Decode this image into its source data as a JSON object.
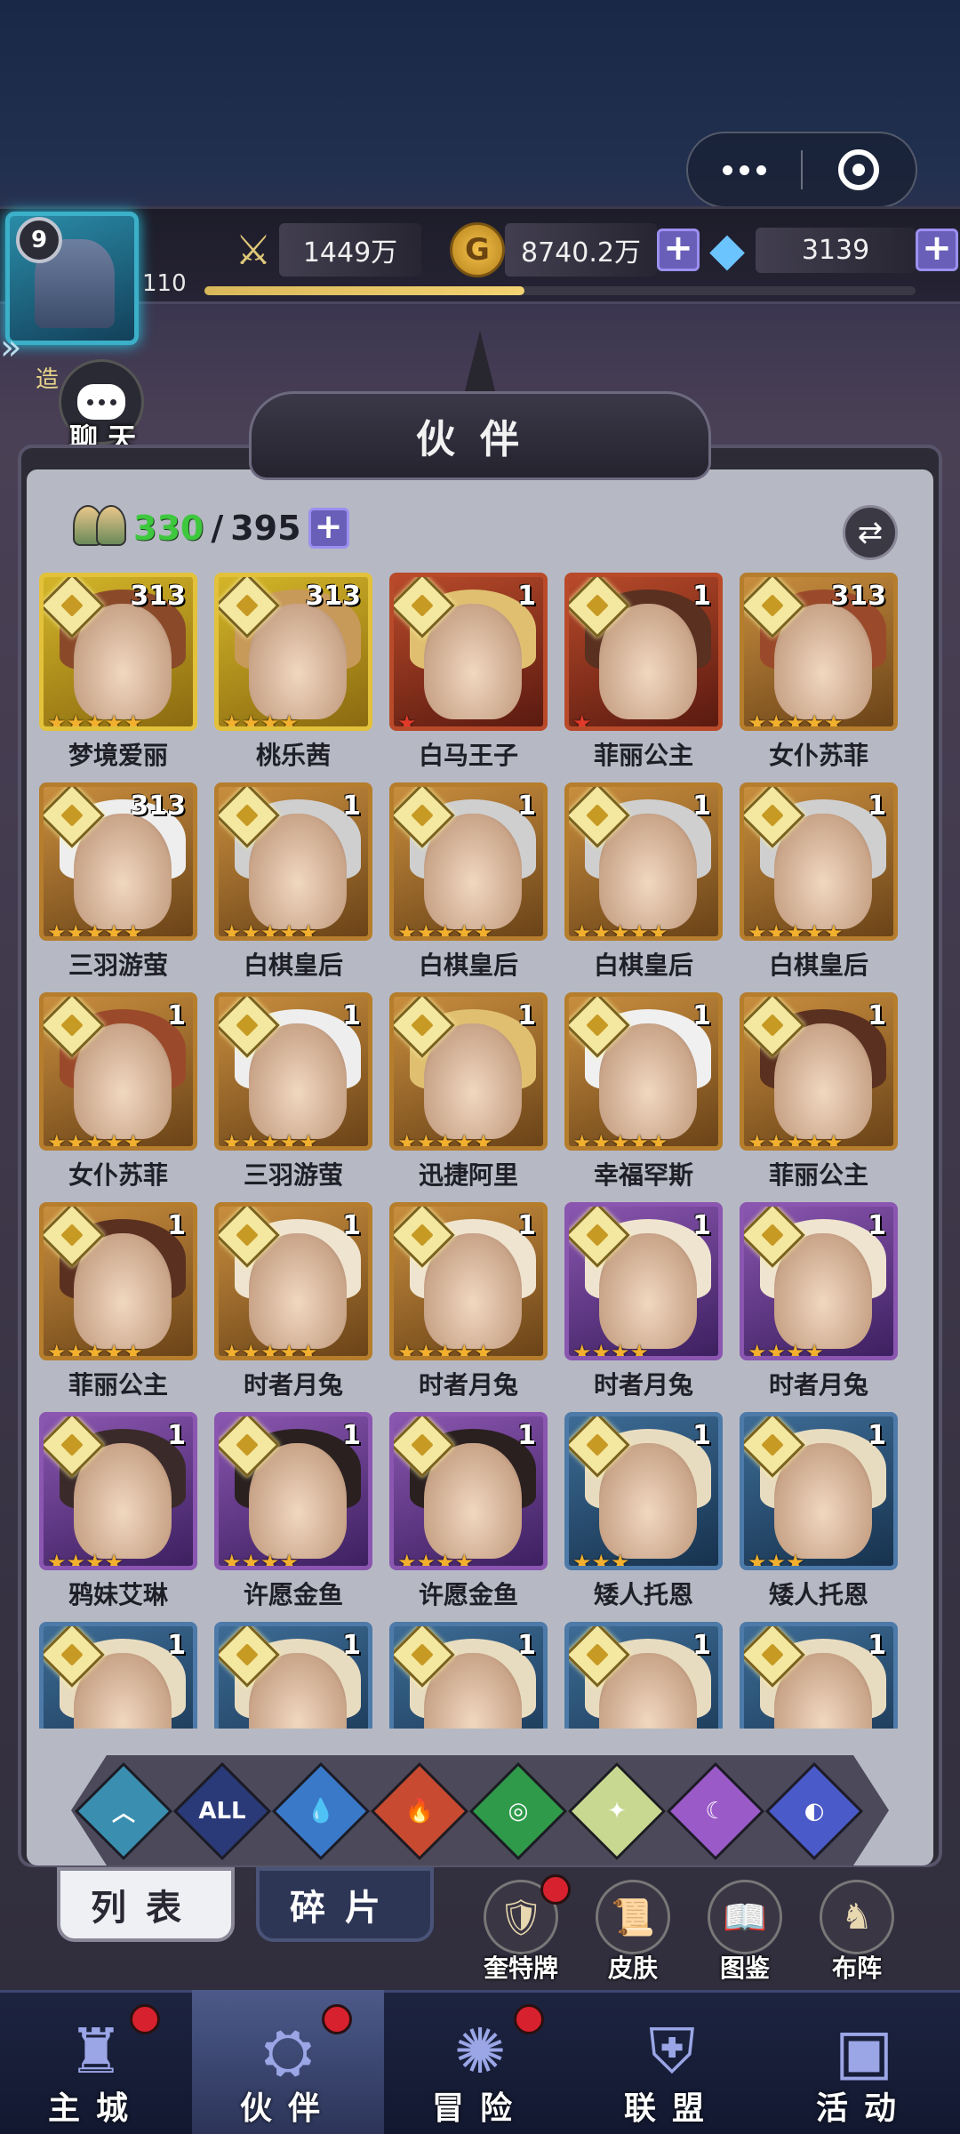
{
  "capsule": {
    "more_icon": "more-dots-icon",
    "close_icon": "target-circle-icon"
  },
  "player": {
    "vip_level": "9",
    "level": "110",
    "xp_fraction": 0.45
  },
  "resources": {
    "power": "1449万",
    "gold": "8740.2万",
    "gems": "3139"
  },
  "side": {
    "chat_label": "聊 天",
    "partial_label": "造"
  },
  "panel": {
    "title": "伙伴"
  },
  "roster": {
    "current": "330",
    "separator": "/",
    "max": "395"
  },
  "heroes": [
    {
      "name": "梦境爱丽",
      "level": "313",
      "stars": 5,
      "frame": "gold"
    },
    {
      "name": "桃乐茜",
      "level": "313",
      "stars": 4,
      "frame": "gold"
    },
    {
      "name": "白马王子",
      "level": "1",
      "stars": 1,
      "frame": "red"
    },
    {
      "name": "菲丽公主",
      "level": "1",
      "stars": 1,
      "frame": "red"
    },
    {
      "name": "女仆苏菲",
      "level": "313",
      "stars": 5,
      "frame": "bronze"
    },
    {
      "name": "三羽游萤",
      "level": "313",
      "stars": 5,
      "frame": "bronze"
    },
    {
      "name": "白棋皇后",
      "level": "1",
      "stars": 5,
      "frame": "bronze"
    },
    {
      "name": "白棋皇后",
      "level": "1",
      "stars": 5,
      "frame": "bronze"
    },
    {
      "name": "白棋皇后",
      "level": "1",
      "stars": 5,
      "frame": "bronze"
    },
    {
      "name": "白棋皇后",
      "level": "1",
      "stars": 5,
      "frame": "bronze"
    },
    {
      "name": "女仆苏菲",
      "level": "1",
      "stars": 5,
      "frame": "bronze"
    },
    {
      "name": "三羽游萤",
      "level": "1",
      "stars": 5,
      "frame": "bronze"
    },
    {
      "name": "迅捷阿里",
      "level": "1",
      "stars": 5,
      "frame": "bronze"
    },
    {
      "name": "幸福罕斯",
      "level": "1",
      "stars": 5,
      "frame": "bronze"
    },
    {
      "name": "菲丽公主",
      "level": "1",
      "stars": 5,
      "frame": "bronze"
    },
    {
      "name": "菲丽公主",
      "level": "1",
      "stars": 5,
      "frame": "bronze"
    },
    {
      "name": "时者月兔",
      "level": "1",
      "stars": 5,
      "frame": "bronze"
    },
    {
      "name": "时者月兔",
      "level": "1",
      "stars": 5,
      "frame": "bronze"
    },
    {
      "name": "时者月兔",
      "level": "1",
      "stars": 4,
      "frame": "purple"
    },
    {
      "name": "时者月兔",
      "level": "1",
      "stars": 4,
      "frame": "purple"
    },
    {
      "name": "鸦妹艾琳",
      "level": "1",
      "stars": 4,
      "frame": "purple"
    },
    {
      "name": "许愿金鱼",
      "level": "1",
      "stars": 4,
      "frame": "purple"
    },
    {
      "name": "许愿金鱼",
      "level": "1",
      "stars": 4,
      "frame": "purple"
    },
    {
      "name": "矮人托恩",
      "level": "1",
      "stars": 3,
      "frame": "blue"
    },
    {
      "name": "矮人托恩",
      "level": "1",
      "stars": 3,
      "frame": "blue"
    },
    {
      "name": "",
      "level": "1",
      "stars": 0,
      "frame": "blue"
    },
    {
      "name": "",
      "level": "1",
      "stars": 0,
      "frame": "blue"
    },
    {
      "name": "",
      "level": "1",
      "stars": 0,
      "frame": "blue"
    },
    {
      "name": "",
      "level": "1",
      "stars": 0,
      "frame": "blue"
    },
    {
      "name": "",
      "level": "1",
      "stars": 0,
      "frame": "blue"
    }
  ],
  "filters": [
    {
      "id": "shield",
      "label": "",
      "color": "#3a8fb0"
    },
    {
      "id": "all",
      "label": "ALL",
      "color": "#2a3a78"
    },
    {
      "id": "water",
      "label": "",
      "color": "#3a78c8"
    },
    {
      "id": "fire",
      "label": "",
      "color": "#c84a30"
    },
    {
      "id": "wind",
      "label": "",
      "color": "#2e9a4a"
    },
    {
      "id": "light",
      "label": "",
      "color": "#c8d890"
    },
    {
      "id": "moon",
      "label": "",
      "color": "#9a5ac8"
    },
    {
      "id": "planet",
      "label": "",
      "color": "#4a5ac8"
    }
  ],
  "subtabs": {
    "list": "列表",
    "shards": "碎片"
  },
  "tools": [
    {
      "label": "奎特牌",
      "icon": "card-shield-icon",
      "badge": true
    },
    {
      "label": "皮肤",
      "icon": "scroll-icon",
      "badge": false
    },
    {
      "label": "图鉴",
      "icon": "book-icon",
      "badge": false
    },
    {
      "label": "布阵",
      "icon": "formation-icon",
      "badge": false
    }
  ],
  "nav": [
    {
      "label": "主城",
      "icon": "castle-icon",
      "badge": true
    },
    {
      "label": "伙伴",
      "icon": "witch-hat-icon",
      "badge": true
    },
    {
      "label": "冒险",
      "icon": "portal-icon",
      "badge": true
    },
    {
      "label": "联盟",
      "icon": "guild-shield-icon",
      "badge": false
    },
    {
      "label": "活动",
      "icon": "cards-icon",
      "badge": false
    }
  ]
}
